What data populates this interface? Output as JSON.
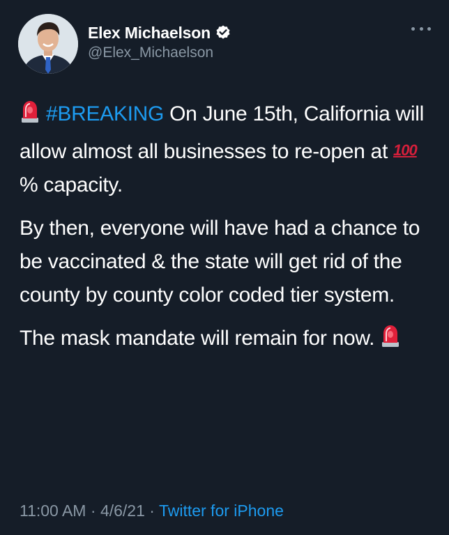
{
  "author": {
    "display_name": "Elex Michaelson",
    "handle": "@Elex_Michaelson",
    "verified": true
  },
  "tweet": {
    "hashtag": "#BREAKING",
    "p1_after_hashtag": "On June 15th, California will allow almost all businesses to re-open at",
    "hundred_emoji": "💯",
    "p1_end": "% capacity.",
    "p2": "By then, everyone will have had a chance to be vaccinated & the state will get rid of the county by county color coded tier system.",
    "p3": "The mask mandate will remain for now."
  },
  "meta": {
    "time": "11:00 AM",
    "separator": "·",
    "date": "4/6/21",
    "source": "Twitter for iPhone"
  },
  "icons": [
    "avatar",
    "verified-badge-icon",
    "more-options-icon",
    "siren-emoji-icon",
    "hundred-points-emoji-icon"
  ],
  "colors": {
    "background": "#151d28",
    "text": "#ffffff",
    "secondary": "#8a98a5",
    "link": "#1d9bf0",
    "siren": "#e0203a"
  }
}
